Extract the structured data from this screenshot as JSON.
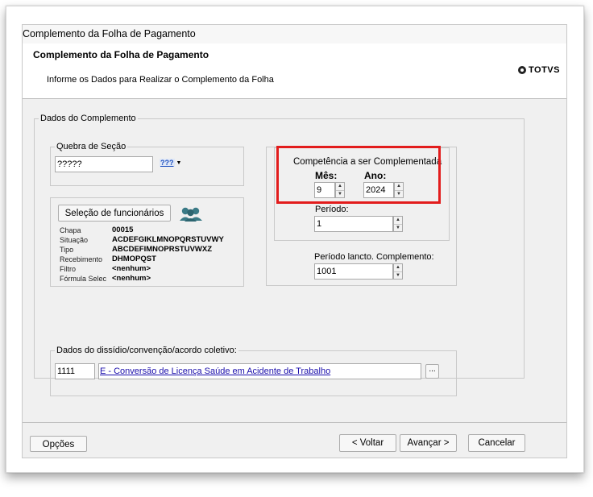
{
  "window": {
    "title": "Complemento da Folha de Pagamento"
  },
  "header": {
    "title": "Complemento da Folha de Pagamento",
    "subtitle": "Informe os Dados para Realizar o Complemento da Folha",
    "logo_text": "TOTVS"
  },
  "dados": {
    "legend": "Dados do Complemento",
    "quebra": {
      "legend": "Quebra de Seção",
      "value": "?????",
      "lookup_label": "???"
    },
    "selecao": {
      "button_label": "Seleção de funcionários",
      "rows": [
        {
          "label": "Chapa",
          "value": "00015"
        },
        {
          "label": "Situação",
          "value": "ACDEFGIKLMNOPQRSTUVWY"
        },
        {
          "label": "Tipo",
          "value": "ABCDEFIMNOPRSTUVWXZ"
        },
        {
          "label": "Recebimento",
          "value": "DHMOPQST"
        },
        {
          "label": "Filtro",
          "value": "<nenhum>"
        },
        {
          "label": "Fórmula Selec",
          "value": "<nenhum>"
        }
      ]
    },
    "competencia": {
      "legend": "Competência a ser Complementada",
      "mes_label": "Mês:",
      "mes_value": "9",
      "ano_label": "Ano:",
      "ano_value": "2024",
      "periodo_label": "Período:",
      "periodo_value": "1"
    },
    "periodo_lancto": {
      "label": "Período lancto. Complemento:",
      "value": "1001"
    },
    "dissidio": {
      "legend": "Dados do dissídio/convenção/acordo coletivo:",
      "code": "1111",
      "description": "E - Conversão de Licença Saúde em Acidente de Trabalho",
      "browse_label": "..."
    }
  },
  "footer": {
    "options_label": "Opções",
    "back_label": "< Voltar",
    "next_label": "Avançar >",
    "cancel_label": "Cancelar"
  },
  "colors": {
    "highlight": "#e21c1c",
    "link": "#1a0dab",
    "icon_people": "#3a7a86"
  }
}
